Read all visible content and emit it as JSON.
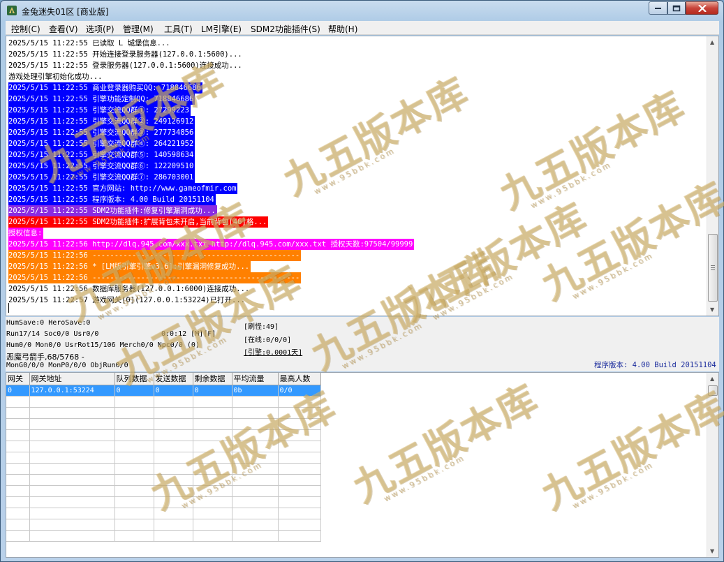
{
  "window": {
    "title": "金兔迷失01区 [商业版]"
  },
  "menu": [
    "控制(C)",
    "查看(V)",
    "选项(P)",
    "管理(M)",
    "工具(T)",
    "LM引擎(E)",
    "SDM2功能插件(S)",
    "帮助(H)"
  ],
  "log": [
    {
      "text": "2025/5/15 11:22:55 已读取 L 城堡信息...",
      "bg": "",
      "fg": "#000000"
    },
    {
      "text": "2025/5/15 11:22:55 开始连接登录服务器(127.0.0.1:5600)...",
      "bg": "",
      "fg": "#000000"
    },
    {
      "text": "2025/5/15 11:22:55 登录服务器(127.0.0.1:5600)连接成功...",
      "bg": "",
      "fg": "#000000"
    },
    {
      "text": "游戏处理引擎初始化成功...",
      "bg": "",
      "fg": "#000000"
    },
    {
      "text": "2025/5/15 11:22:55 商业登录器购买QQ: 718846686",
      "bg": "#0000ff",
      "fg": "#ffffff"
    },
    {
      "text": "2025/5/15 11:22:55 引擎功能定制QQ: 718846686",
      "bg": "#0000ff",
      "fg": "#ffffff"
    },
    {
      "text": "2025/5/15 11:22:55 引擎交流QQ群①: 27299223",
      "bg": "#0000ff",
      "fg": "#ffffff"
    },
    {
      "text": "2025/5/15 11:22:55 引擎交流QQ群②: 249126912",
      "bg": "#0000ff",
      "fg": "#ffffff"
    },
    {
      "text": "2025/5/15 11:22:55 引擎交流QQ群③: 277734856",
      "bg": "#0000ff",
      "fg": "#ffffff"
    },
    {
      "text": "2025/5/15 11:22:55 引擎交流QQ群④: 264221952",
      "bg": "#0000ff",
      "fg": "#ffffff"
    },
    {
      "text": "2025/5/15 11:22:55 引擎交流QQ群⑤: 140598634",
      "bg": "#0000ff",
      "fg": "#ffffff"
    },
    {
      "text": "2025/5/15 11:22:55 引擎交流QQ群⑥: 122209510",
      "bg": "#0000ff",
      "fg": "#ffffff"
    },
    {
      "text": "2025/5/15 11:22:55 引擎交流QQ群⑦: 286703001",
      "bg": "#0000ff",
      "fg": "#ffffff"
    },
    {
      "text": "2025/5/15 11:22:55 官方网站: http://www.gameofmir.com",
      "bg": "#0000ff",
      "fg": "#ffffff"
    },
    {
      "text": "2025/5/15 11:22:55 程序版本: 4.00 Build 20151104",
      "bg": "#0000ff",
      "fg": "#ffffff"
    },
    {
      "text": "2025/5/15 11:22:55 SDM2功能插件:修复引擎漏洞成功...",
      "bg": "#8a2be2",
      "fg": "#ffffff"
    },
    {
      "text": "2025/5/15 11:22:55 SDM2功能插件:扩展背包未开启,当前背包[46]格...",
      "bg": "#ff0000",
      "fg": "#ffffff"
    },
    {
      "text": "授权信息:",
      "bg": "#ff00ff",
      "fg": "#ffffff"
    },
    {
      "text": "2025/5/15 11:22:56 http://dlq.945.com/xxx.txt http://dlq.945.com/xxx.txt 授权天数:97504/99999",
      "bg": "#ff00ff",
      "fg": "#ffffff"
    },
    {
      "text": "2025/5/15 11:22:56 -----------------------------------------------",
      "bg": "#ff8000",
      "fg": "#ffffff"
    },
    {
      "text": "2025/5/15 11:22:56 * [LM版引擎引擎v3.6]:引擎漏洞修复成功...",
      "bg": "#ff8000",
      "fg": "#ffffff"
    },
    {
      "text": "2025/5/15 11:22:56 -----------------------------------------------",
      "bg": "#ff8000",
      "fg": "#ffffff"
    },
    {
      "text": "2025/5/15 11:22:56 数据库服务器(127.0.0.1:6000)连接成功...",
      "bg": "",
      "fg": "#000000"
    },
    {
      "text": "2025/5/15 11:22:57 游戏网关[0](127.0.0.1:53224)已打开...",
      "bg": "",
      "fg": "#000000"
    }
  ],
  "status": {
    "line1": "HumSave:0 HeroSave:0",
    "line2": "Run17/14 Soc0/0 Usr0/0",
    "timer": "0:0:12 [M][F]",
    "line3": "Hum0/0 Mon0/0 UsrRot15/106 Merch0/0 Npc0/0 (0)",
    "line4": "恶魔弓箭手,68/5768 -",
    "line5": "MonG0/0/0 MonP0/0/0 ObjRun0/0",
    "refresh": "[刷怪:49]",
    "online": "[在线:0/0/0]",
    "engine": "[引擎:0.0001天]",
    "version": "程序版本: 4.00 Build 20151104"
  },
  "gateway": {
    "columns": [
      "网关",
      "网关地址",
      "队列数据",
      "发送数据",
      "剩余数据",
      "平均流量",
      "最高人数"
    ],
    "rows": [
      [
        "0",
        "127.0.0.1:53224",
        "0",
        "0",
        "0",
        "0b",
        "0/0"
      ]
    ]
  },
  "watermark": {
    "text": "九五版本库",
    "sub": "www.95bbk.com"
  },
  "colors": {
    "title_bar": "#b9d1ea",
    "selection": "#3399ff",
    "version_text": "#1a2b9c"
  }
}
